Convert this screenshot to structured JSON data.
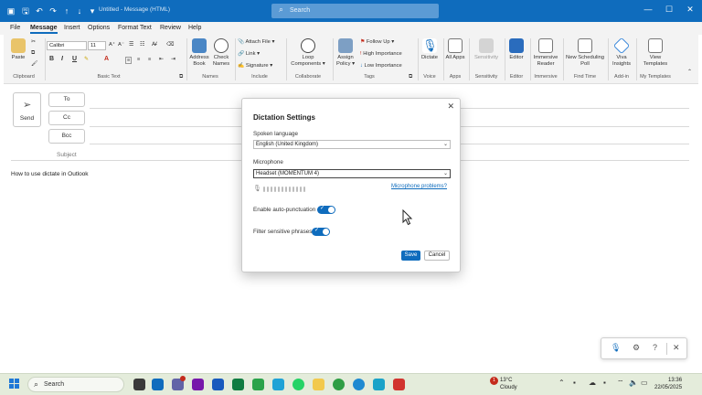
{
  "titlebar": {
    "title": "Untitled - Message (HTML)",
    "search_placeholder": "Search"
  },
  "tabs": [
    "File",
    "Message",
    "Insert",
    "Options",
    "Format Text",
    "Review",
    "Help"
  ],
  "ribbon": {
    "clipboard": {
      "paste": "Paste",
      "label": "Clipboard"
    },
    "basic_text": {
      "font": "Calibri",
      "size": "11",
      "label": "Basic Text"
    },
    "names": {
      "address_book": "Address Book",
      "check_names": "Check Names",
      "label": "Names"
    },
    "include": {
      "attach": "Attach File",
      "link": "Link",
      "signature": "Signature",
      "label": "Include"
    },
    "collaborate": {
      "loop": "Loop Components",
      "label": "Collaborate"
    },
    "tags": {
      "assign_policy": "Assign Policy",
      "follow_up": "Follow Up",
      "high": "High Importance",
      "low": "Low Importance",
      "label": "Tags"
    },
    "voice": {
      "dictate": "Dictate",
      "label": "Voice"
    },
    "apps": {
      "all_apps": "All Apps",
      "label": "Apps"
    },
    "sensitivity": {
      "sensitivity": "Sensitivity",
      "label": "Sensitivity"
    },
    "editor": {
      "editor": "Editor",
      "label": "Editor"
    },
    "immersive": {
      "reader": "Immersive Reader",
      "label": "Immersive"
    },
    "find_time": {
      "poll": "New Scheduling Poll",
      "label": "Find Time"
    },
    "addin": {
      "viva": "Viva Insights",
      "label": "Add-in"
    },
    "templates": {
      "view": "View Templates",
      "label": "My Templates"
    }
  },
  "compose": {
    "send": "Send",
    "to": "To",
    "cc": "Cc",
    "bcc": "Bcc",
    "subject": "Subject",
    "body": "How to use dictate in Outlook"
  },
  "dialog": {
    "title": "Dictation Settings",
    "spoken_language_label": "Spoken language",
    "spoken_language_value": "English (United Kingdom)",
    "microphone_label": "Microphone",
    "microphone_value": "Headset (MOMENTUM 4)",
    "mic_problems_link": "Microphone problems?",
    "auto_punct_label": "Enable auto-punctuation",
    "auto_punct_on": true,
    "filter_label": "Filter sensitive phrases",
    "filter_on": true,
    "save": "Save",
    "cancel": "Cancel"
  },
  "taskbar": {
    "search_placeholder": "Search",
    "weather_temp": "13°C",
    "weather_desc": "Cloudy",
    "weather_badge": "1",
    "time": "13:36",
    "date": "22/05/2025"
  },
  "colors": {
    "accent": "#0f6cbd",
    "taskbar": "#e4ecdb"
  }
}
